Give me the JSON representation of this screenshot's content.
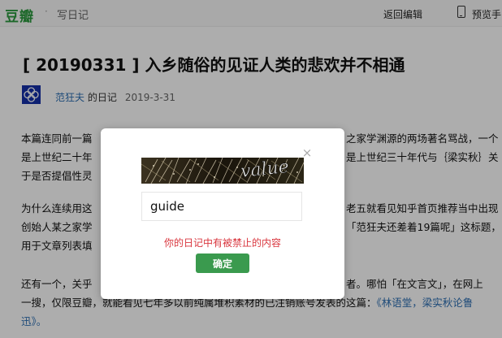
{
  "header": {
    "logo": "豆瓣",
    "separator": "·",
    "section": "写日记",
    "back_to_edit": "返回编辑",
    "preview": "预览手"
  },
  "article": {
    "title": "[ 20190331 ] 入乡随俗的见证人类的悲欢并不相通",
    "author": "范狂夫",
    "author_suffix": " 的日记",
    "date": "2019-3-31",
    "paragraphs": [
      {
        "lines": [
          {
            "text": "本篇连同前一篇"
          },
          {
            "text": "是上世纪二十年"
          },
          {
            "text": "于是否提倡性灵"
          }
        ],
        "right_lines": [
          {
            "text": "之家学渊源的两场著名骂战，一个"
          },
          {
            "text": "是上世纪三十年代与｛梁实秋｝关"
          }
        ]
      },
      {
        "lines": [
          {
            "text": "为什么连续用这"
          },
          {
            "text": "创始人某之家学"
          },
          {
            "text": "用于文章列表填"
          }
        ],
        "right_lines": [
          {
            "text": "老五就看见知乎首页推荐当中出现"
          },
          {
            "text": "「范狂夫还差着19篇呢」这标题，"
          }
        ]
      },
      {
        "line1_left": "还有一个，关乎",
        "line1_right": "者。哪怕「在文言文」，在网上",
        "line2": "一搜，仅限豆瓣，就能看见七年多以前纯属堆积素材的已注销账号发表的这篇：",
        "link": "《林语堂，梁实秋论鲁",
        "line3": "迅》。"
      }
    ]
  },
  "dialog": {
    "captcha_text": "value",
    "input_value": "guide",
    "error": "你的日记中有被禁止的内容",
    "confirm_label": "确定",
    "close_symbol": "×"
  },
  "colors": {
    "brand_green": "#2c9a3f",
    "button_green": "#3a9a4e",
    "error_red": "#d9363e",
    "link_blue": "#2d6fb3",
    "avatar_blue": "#1630a8"
  }
}
